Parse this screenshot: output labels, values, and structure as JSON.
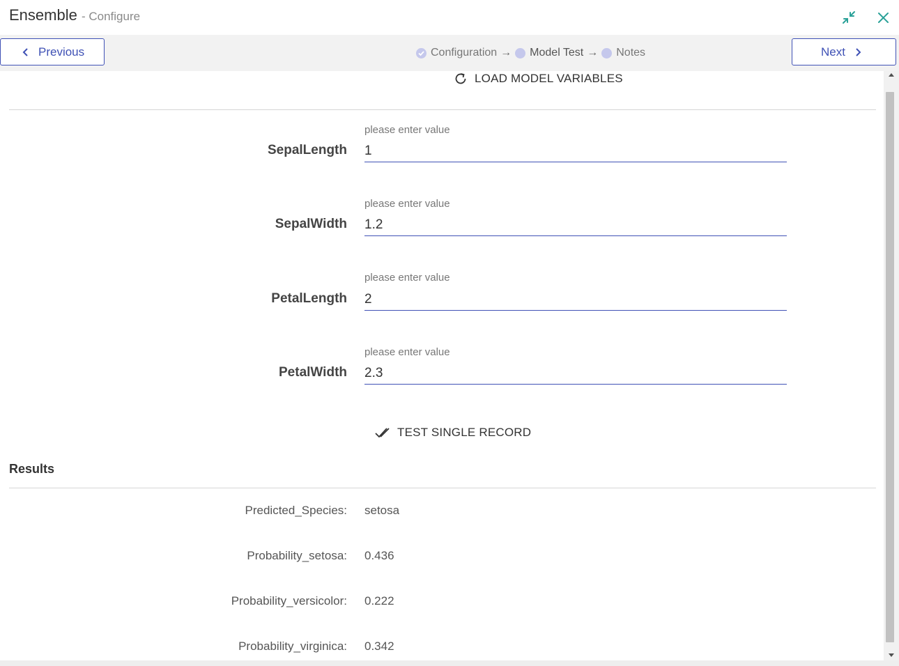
{
  "window": {
    "title": "Ensemble",
    "subtitle": "- Configure",
    "minimize_icon": "collapse-arrows-icon",
    "close_icon": "close-icon",
    "accent_color": "#2aa198"
  },
  "nav": {
    "previous_label": "Previous",
    "next_label": "Next",
    "steps": [
      {
        "label": "Configuration",
        "state": "completed"
      },
      {
        "label": "Model Test",
        "state": "active"
      },
      {
        "label": "Notes",
        "state": "pending"
      }
    ],
    "arrow": "→",
    "button_color": "#3f51b5"
  },
  "actions": {
    "load_label": "LOAD MODEL VARIABLES",
    "test_label": "TEST SINGLE RECORD"
  },
  "fields": [
    {
      "label": "SepalLength",
      "hint": "please enter value",
      "value": "1"
    },
    {
      "label": "SepalWidth",
      "hint": "please enter value",
      "value": "1.2"
    },
    {
      "label": "PetalLength",
      "hint": "please enter value",
      "value": "2"
    },
    {
      "label": "PetalWidth",
      "hint": "please enter value",
      "value": "2.3"
    }
  ],
  "results": {
    "title": "Results",
    "rows": [
      {
        "key": "Predicted_Species:",
        "value": "setosa"
      },
      {
        "key": "Probability_setosa:",
        "value": "0.436"
      },
      {
        "key": "Probability_versicolor:",
        "value": "0.222"
      },
      {
        "key": "Probability_virginica:",
        "value": "0.342"
      }
    ]
  }
}
